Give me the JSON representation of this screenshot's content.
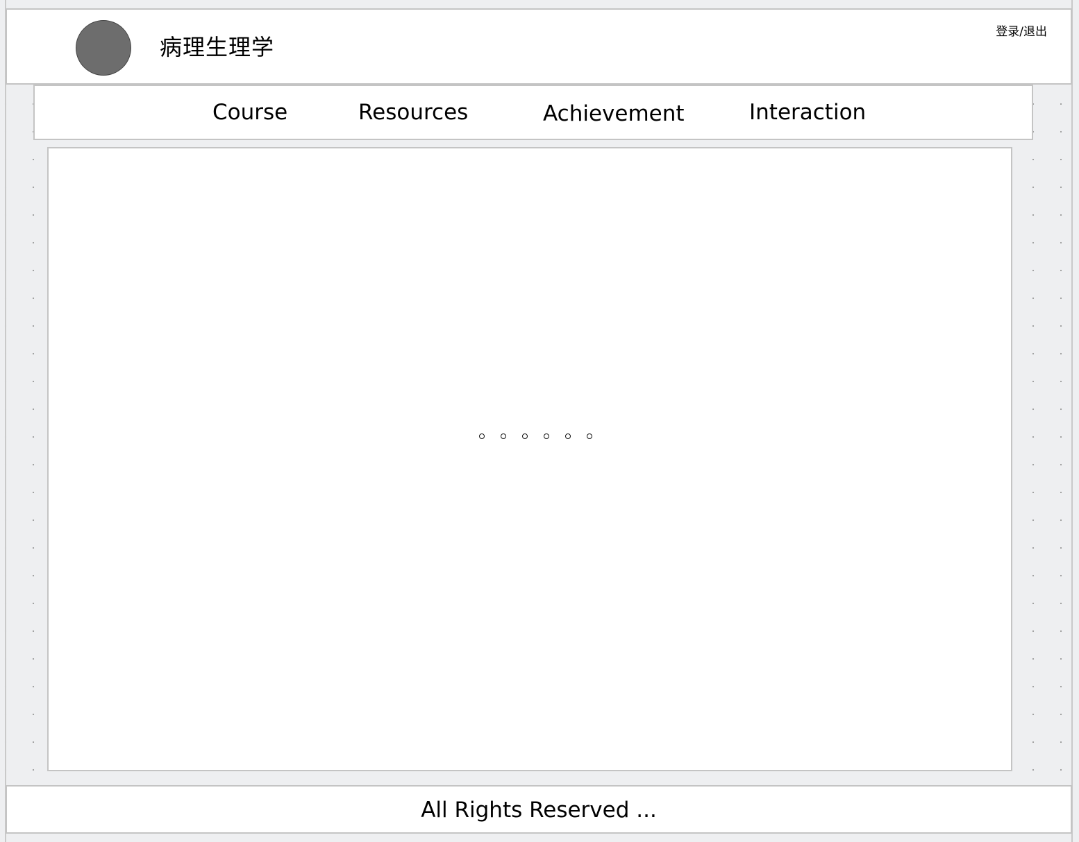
{
  "header": {
    "title": "病理生理学",
    "auth_link": "登录/退出",
    "avatar_icon": "avatar-circle-icon"
  },
  "nav": {
    "items": [
      {
        "label": "Course"
      },
      {
        "label": "Resources"
      },
      {
        "label": "Achievement"
      },
      {
        "label": "Interaction"
      }
    ]
  },
  "main": {
    "placeholder": "。。。。。。"
  },
  "footer": {
    "text": "All Rights Reserved ..."
  },
  "colors": {
    "canvas_background": "#eeeff1",
    "panel_background": "#ffffff",
    "panel_border": "#c4c4c4",
    "avatar_fill": "#6d6d6d"
  }
}
